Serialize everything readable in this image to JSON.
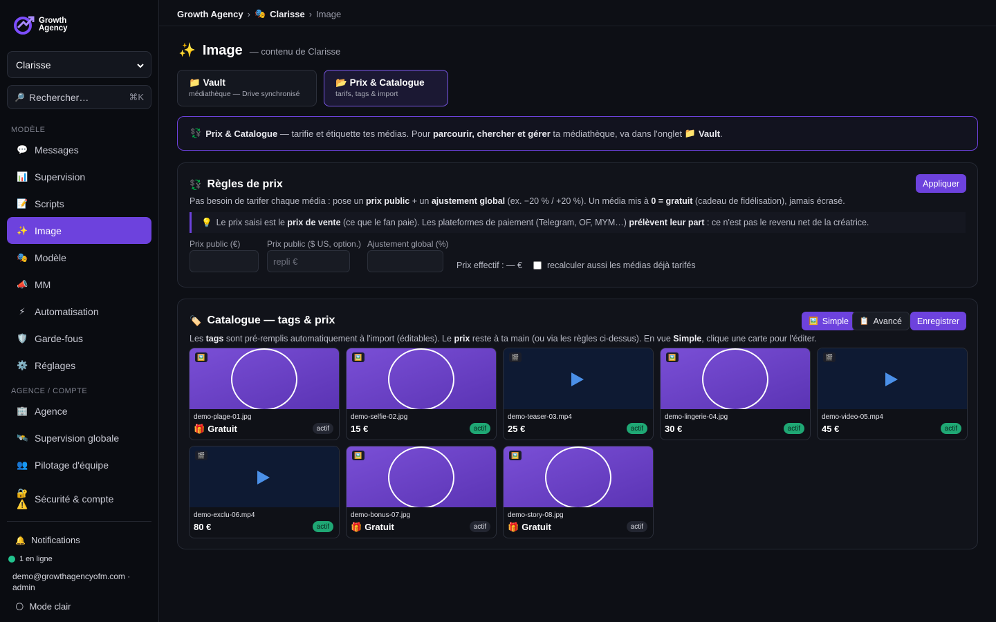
{
  "brand": {
    "name_line1": "Growth",
    "name_line2": "Agency"
  },
  "sidebar": {
    "model_select": "Clarisse",
    "search": {
      "label": "Rechercher…",
      "shortcut": "⌘K"
    },
    "section_model": "MODÈLE",
    "section_agency": "AGENCE / COMPTE",
    "items": [
      {
        "icon": "💬",
        "label": "Messages"
      },
      {
        "icon": "📊",
        "label": "Supervision"
      },
      {
        "icon": "📝",
        "label": "Scripts"
      },
      {
        "icon": "✨",
        "label": "Image"
      },
      {
        "icon": "🎭",
        "label": "Modèle"
      },
      {
        "icon": "📣",
        "label": "MM"
      },
      {
        "icon": "⚡",
        "label": "Automatisation"
      },
      {
        "icon": "🛡️",
        "label": "Garde-fous"
      },
      {
        "icon": "⚙️",
        "label": "Réglages"
      }
    ],
    "agency_items": [
      {
        "icon": "🏢",
        "label": "Agence"
      },
      {
        "icon": "🛰️",
        "label": "Supervision globale"
      },
      {
        "icon": "👥",
        "label": "Pilotage d'équipe"
      },
      {
        "icon": "🔐",
        "label": "Sécurité & compte",
        "icon2": "⚠️"
      }
    ],
    "notifications": "Notifications",
    "online": "1 en ligne",
    "account": "demo@growthagencyofm.com · admin",
    "mode": "Mode clair"
  },
  "breadcrumb": {
    "agency": "Growth Agency",
    "model": "Clarisse",
    "page": "Image"
  },
  "header": {
    "title": "Image",
    "subtitle": "— contenu de Clarisse"
  },
  "tabs": [
    {
      "label": "Vault",
      "desc": "médiathèque — Drive synchronisé"
    },
    {
      "label": "Prix & Catalogue",
      "desc": "tarifs, tags & import"
    }
  ],
  "info": {
    "strong1": "Prix & Catalogue",
    "text1": " — tarifie et étiquette tes médias. Pour ",
    "strong2": "parcourir, chercher et gérer",
    "text2": " ta médiathèque, va dans l'onglet ",
    "strong3": "Vault",
    "text3": "."
  },
  "pricing": {
    "title": "Règles de prix",
    "apply": "Appliquer",
    "desc": [
      "Pas besoin de tarifer chaque média : pose un ",
      "prix public",
      " + un ",
      "ajustement global",
      " (ex. −20 % / +20 %). Un média mis à ",
      "0 = gratuit",
      " (cadeau de fidélisation), jamais écrasé."
    ],
    "note": [
      "Le prix saisi est le ",
      "prix de vente",
      " (ce que le fan paie). Les plateformes de paiement (Telegram, OF, MYM…) ",
      "prélèvent leur part",
      " : ce n'est pas le revenu net de la créatrice."
    ],
    "fields": [
      {
        "label": "Prix public (€)",
        "value": ""
      },
      {
        "label": "Prix public ($ US, option.)",
        "placeholder": "repli €"
      },
      {
        "label": "Ajustement global (%)",
        "value": ""
      }
    ],
    "effective": "Prix effectif : — €",
    "recalc": "recalculer aussi les médias déjà tarifés"
  },
  "catalogue": {
    "title": "Catalogue — tags & prix",
    "btn_simple": "Simple",
    "btn_advanced": "Avancé",
    "btn_save": "Enregistrer",
    "desc": [
      "Les ",
      "tags",
      " sont pré-remplis automatiquement à l'import (éditables). Le ",
      "prix",
      " reste à ta main (ou via les règles ci-dessus). En vue ",
      "Simple",
      ", clique une carte pour l'éditer."
    ],
    "items": [
      {
        "name": "demo-plage-01.jpg",
        "kind": "image",
        "price": "Gratuit",
        "free": true,
        "status": "actif"
      },
      {
        "name": "demo-selfie-02.jpg",
        "kind": "image",
        "price": "15 €",
        "free": false,
        "status": "actif"
      },
      {
        "name": "demo-teaser-03.mp4",
        "kind": "video",
        "price": "25 €",
        "free": false,
        "status": "actif"
      },
      {
        "name": "demo-lingerie-04.jpg",
        "kind": "image",
        "price": "30 €",
        "free": false,
        "status": "actif"
      },
      {
        "name": "demo-video-05.mp4",
        "kind": "video",
        "price": "45 €",
        "free": false,
        "status": "actif"
      },
      {
        "name": "demo-exclu-06.mp4",
        "kind": "video",
        "price": "80 €",
        "free": false,
        "status": "actif"
      },
      {
        "name": "demo-bonus-07.jpg",
        "kind": "image",
        "price": "Gratuit",
        "free": true,
        "status": "actif"
      },
      {
        "name": "demo-story-08.jpg",
        "kind": "image",
        "price": "Gratuit",
        "free": true,
        "status": "actif"
      }
    ]
  },
  "colors": {
    "accent": "#6d42dd",
    "active_badge": "#1fa774"
  }
}
